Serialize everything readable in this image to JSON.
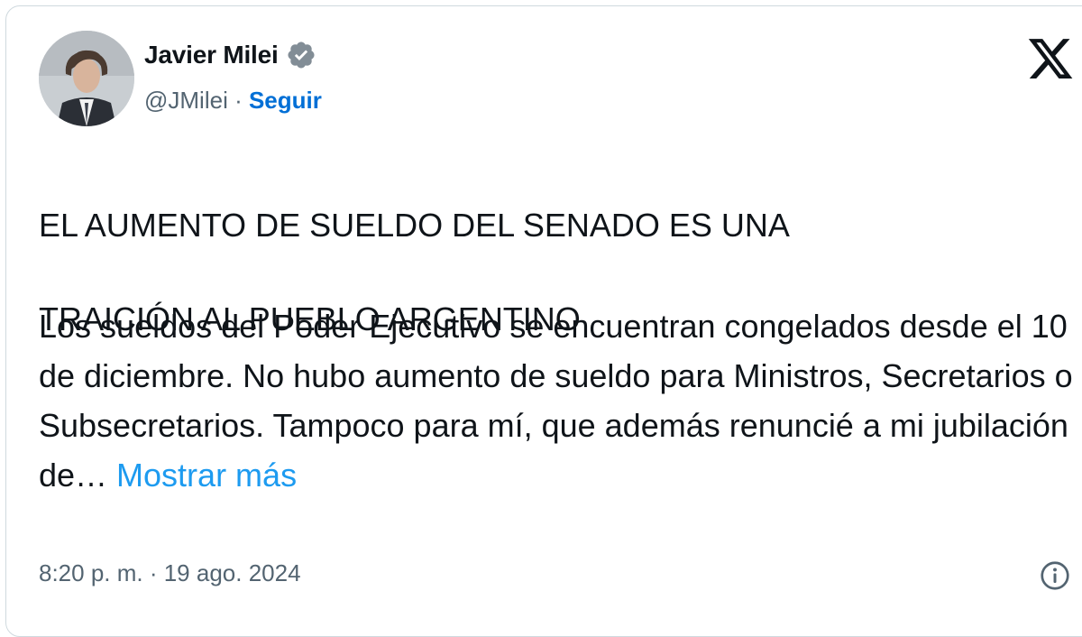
{
  "author": {
    "name": "Javier Milei",
    "handle": "@JMilei",
    "separator": " · ",
    "follow_label": "Seguir"
  },
  "icons": {
    "verified": "verified-badge-icon",
    "logo": "x-logo-icon",
    "info": "info-icon"
  },
  "tweet": {
    "headline_line1": "EL AUMENTO DE SUELDO DEL SENADO ES UNA",
    "headline_line2": "TRAICIÓN AL PUEBLO ARGENTINO",
    "body": "Los sueldos del Poder Ejecutivo se encuentran congelados desde el 10 de diciembre. No hubo aumento de sueldo para Ministros, Secretarios o Subsecretarios. Tampoco para mí, que además renuncié a mi jubilación de… ",
    "show_more": "Mostrar más",
    "timestamp": "8:20 p. m. · 19 ago. 2024"
  },
  "colors": {
    "link": "#1d9bf0",
    "follow": "#006fd6",
    "text": "#0f1419",
    "muted": "#536471",
    "border": "#cfd9de"
  }
}
